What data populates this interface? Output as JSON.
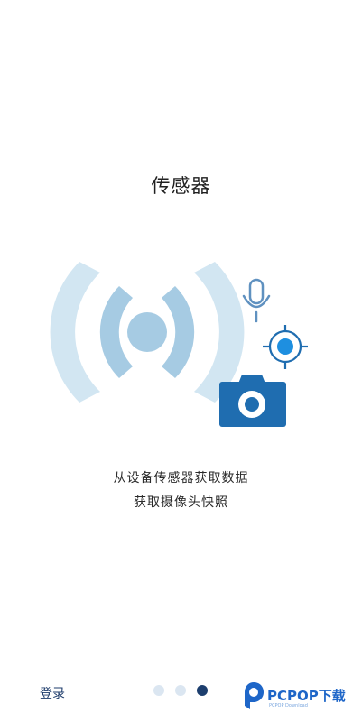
{
  "page": {
    "title": "传感器",
    "description_line1": "从设备传感器获取数据",
    "description_line2": "获取摄像头快照"
  },
  "footer": {
    "login_label": "登录",
    "pager": {
      "total": 3,
      "current": 3
    }
  },
  "watermark": {
    "text": "PCPOP下载",
    "subtext": "PCPOP Download"
  },
  "icons": {
    "signal": "wireless-signal-icon",
    "mic": "microphone-icon",
    "target": "location-target-icon",
    "camera": "camera-icon"
  },
  "colors": {
    "outer_wave": "#d2e6f2",
    "inner_wave": "#a6cbe3",
    "accent": "#1f6db0",
    "mic_stroke": "#5f91c0",
    "target_fill": "#1e8fe0",
    "dot_active": "#1c3e6e",
    "dot_inactive": "#dbe6f1"
  }
}
